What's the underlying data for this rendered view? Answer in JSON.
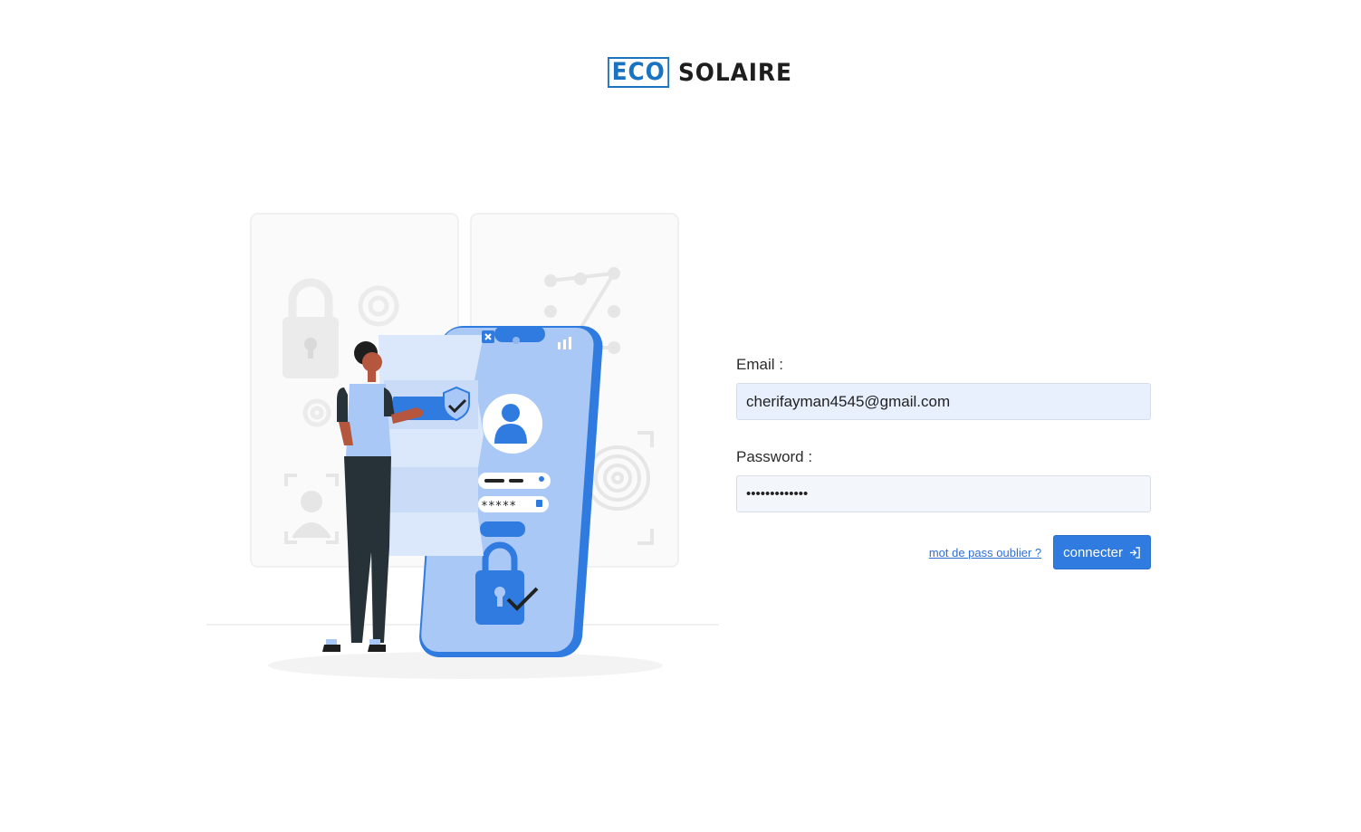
{
  "brand": {
    "logo_boxed": "ECO",
    "logo_rest": "SOLAIRE"
  },
  "form": {
    "email_label": "Email :",
    "email_value": "cherifayman4545@gmail.com",
    "password_label": "Password :",
    "password_value": "•••••••••••••",
    "forgot_link": "mot de pass oublier ?",
    "submit_label": "connecter",
    "submit_icon": "login-icon"
  },
  "illustration": {
    "mask_text": "*****"
  },
  "colors": {
    "accent": "#2f7be0",
    "logo_blue": "#1a73c0",
    "input_bg": "#e8f0fe"
  }
}
